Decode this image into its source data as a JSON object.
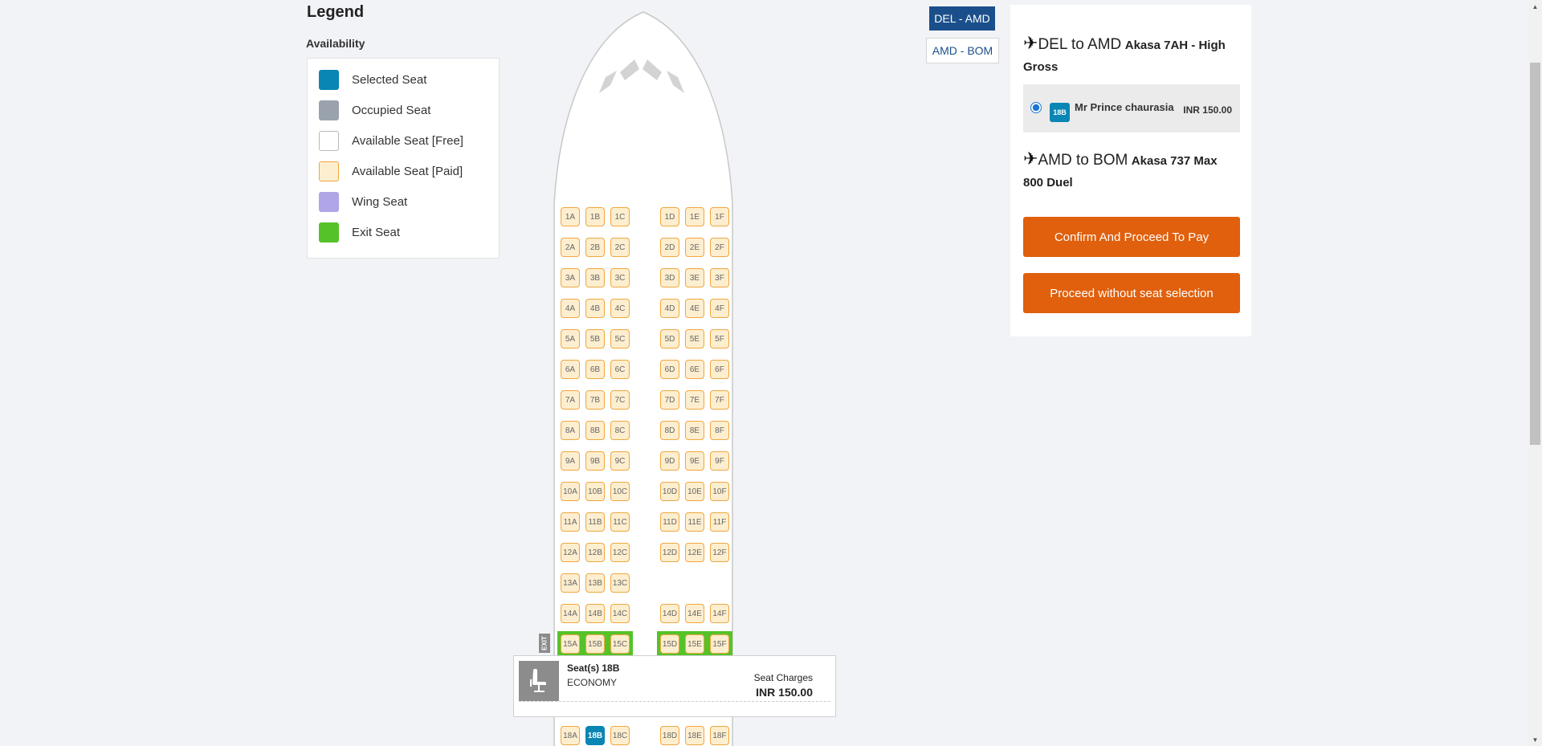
{
  "legend": {
    "title": "Legend",
    "subtitle": "Availability",
    "items": [
      {
        "label": "Selected Seat",
        "color": "#0a86b4",
        "border": "#0a86b4"
      },
      {
        "label": "Occupied Seat",
        "color": "#9aa3ad",
        "border": "#9aa3ad"
      },
      {
        "label": "Available Seat [Free]",
        "color": "#ffffff",
        "border": "#b9b9b9"
      },
      {
        "label": "Available Seat [Paid]",
        "color": "#fdeecf",
        "border": "#f0a73e"
      },
      {
        "label": "Wing Seat",
        "color": "#b0a5e6",
        "border": "#b0a5e6"
      },
      {
        "label": "Exit Seat",
        "color": "#56c22a",
        "border": "#56c22a"
      }
    ]
  },
  "seatmap": {
    "rows": [
      "1",
      "2",
      "3",
      "4",
      "5",
      "6",
      "7",
      "8",
      "9",
      "10",
      "11",
      "12",
      "13",
      "14",
      "15",
      "18"
    ],
    "columns": [
      "A",
      "B",
      "C",
      "D",
      "E",
      "F"
    ],
    "left_only_rows": [
      "13"
    ],
    "exit_rows": [
      "15"
    ],
    "selected_seat": "18B",
    "exit_label": "EXIT"
  },
  "popup": {
    "title": "Seat(s) 18B",
    "cabin": "ECONOMY",
    "charges_label": "Seat Charges",
    "charges_value": "INR 150.00",
    "icon": "seat-icon"
  },
  "tabs": {
    "active": "DEL - AMD",
    "inactive": "AMD - BOM"
  },
  "panel": {
    "flight1": {
      "route": "DEL to AMD",
      "aircraft": "Akasa 7AH - High Gross",
      "icon": "airplane-icon"
    },
    "passenger": {
      "seat": "18B",
      "name": "Mr Prince chaurasia",
      "price": "INR 150.00"
    },
    "flight2": {
      "route": "AMD to BOM",
      "aircraft": "Akasa 737 Max 800 Duel",
      "icon": "airplane-icon"
    },
    "confirm_button": "Confirm And Proceed To Pay",
    "skip_button": "Proceed without seat selection"
  }
}
